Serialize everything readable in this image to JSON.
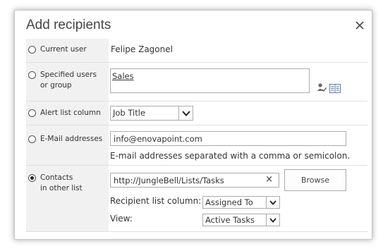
{
  "dialog": {
    "title": "Add recipients",
    "close_icon": "close-icon"
  },
  "rows": {
    "current_user": {
      "label": "Current user",
      "selected": false,
      "value": "Felipe Zagonel"
    },
    "specified_users": {
      "label_line1": "Specified users",
      "label_line2": "or group",
      "selected": false,
      "value": "Sales",
      "icons": [
        "check-names-icon",
        "address-book-icon"
      ]
    },
    "alert_list_column": {
      "label": "Alert list column",
      "selected": false,
      "value": "Job Title"
    },
    "email_addresses": {
      "label": "E-Mail addresses",
      "selected": false,
      "value": "info@enovapoint.com",
      "hint": "E-mail addresses separated with a comma or semicolon."
    },
    "contacts": {
      "label_line1": "Contacts",
      "label_line2": "in other list",
      "selected": true,
      "list_url": "http://JungleBell/Lists/Tasks",
      "clear_symbol": "×",
      "browse_label": "Browse",
      "recipient_column_label": "Recipient list column:",
      "recipient_column_value": "Assigned To",
      "view_label": "View:",
      "view_value": "Active Tasks"
    }
  },
  "colors": {
    "label_background": "#f1f1f1",
    "separator": "#e1e1e1",
    "border": "#ababab"
  }
}
